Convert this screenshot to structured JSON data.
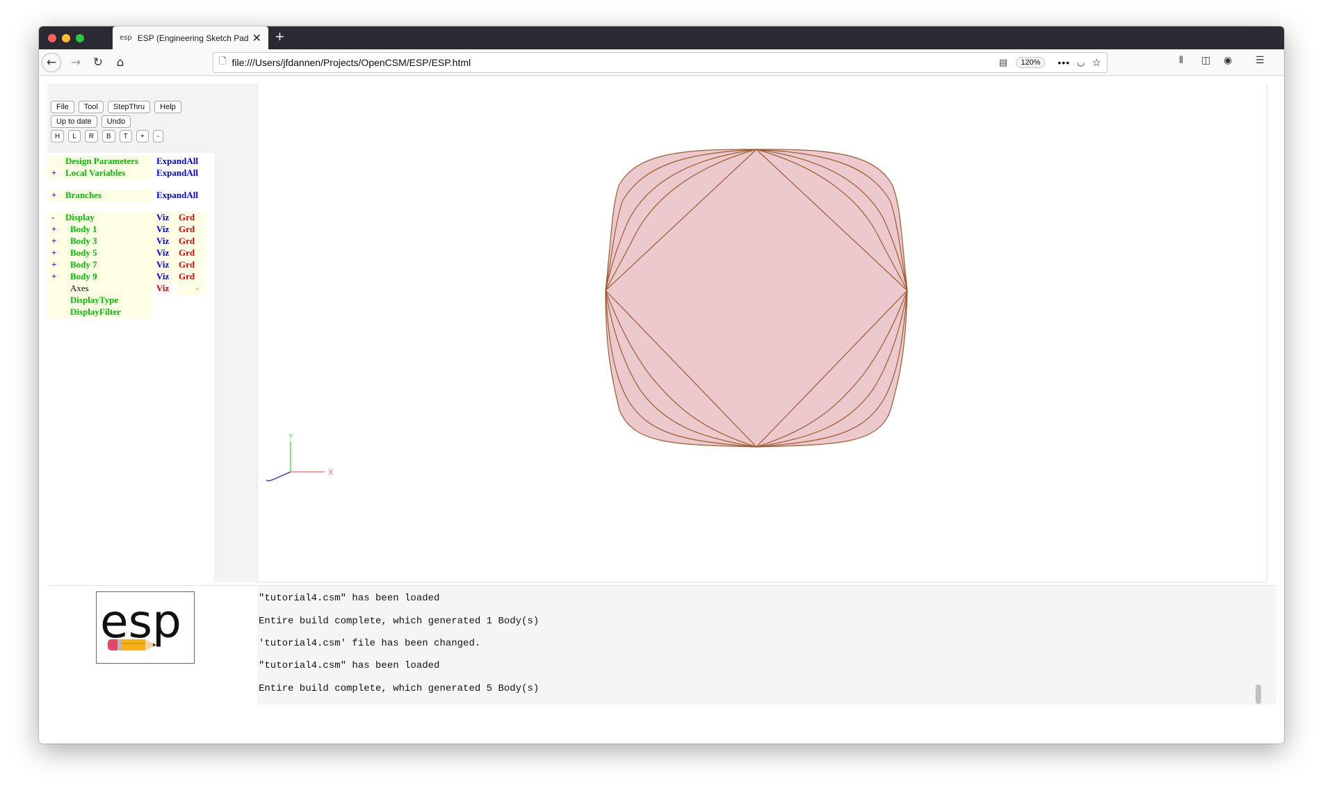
{
  "browser": {
    "tab_title": "ESP (Engineering Sketch Pad, V",
    "tab_favicon": "esp",
    "url": "file:///Users/jfdannen/Projects/OpenCSM/ESP/ESP.html",
    "zoom": "120%"
  },
  "toolbar": {
    "menu_buttons": [
      "File",
      "Tool",
      "StepThru",
      "Help"
    ],
    "status_button": "Up to date",
    "undo_button": "Undo",
    "view_buttons": [
      "H",
      "L",
      "R",
      "B",
      "T",
      "+",
      "-"
    ]
  },
  "tree": {
    "design_parameters": {
      "prefix": "",
      "label": "Design Parameters",
      "action": "ExpandAll"
    },
    "local_variables": {
      "prefix": "+",
      "label": "Local Variables",
      "action": "ExpandAll"
    },
    "branches": {
      "prefix": "+",
      "label": "Branches",
      "action": "ExpandAll"
    },
    "display": {
      "prefix": "-",
      "label": "Display",
      "viz": "Viz",
      "grd": "Grd"
    },
    "bodies": [
      {
        "prefix": "+",
        "label": "Body 1",
        "viz": "Viz",
        "grd": "Grd"
      },
      {
        "prefix": "+",
        "label": "Body 3",
        "viz": "Viz",
        "grd": "Grd"
      },
      {
        "prefix": "+",
        "label": "Body 5",
        "viz": "Viz",
        "grd": "Grd"
      },
      {
        "prefix": "+",
        "label": "Body 7",
        "viz": "Viz",
        "grd": "Grd"
      },
      {
        "prefix": "+",
        "label": "Body 9",
        "viz": "Viz",
        "grd": "Grd"
      }
    ],
    "axes": {
      "label": "Axes",
      "viz": "Viz",
      "grd": "-"
    },
    "display_type": "DisplayType",
    "display_filter": "DisplayFilter"
  },
  "axes_labels": {
    "x": "X",
    "y": "Y"
  },
  "logo_text": "esp",
  "messages": [
    "\"tutorial4.csm\" has been loaded",
    "Entire build complete, which generated 1 Body(s)",
    "'tutorial4.csm' file has been changed.",
    "\"tutorial4.csm\" has been loaded",
    "Entire build complete, which generated 5 Body(s)"
  ],
  "colors": {
    "body_fill": "#ecc9cd",
    "body_edge": "#9a5a2e",
    "tree_green": "#00bb00",
    "tree_blue": "#0000dd",
    "tree_red": "#dd0000"
  }
}
